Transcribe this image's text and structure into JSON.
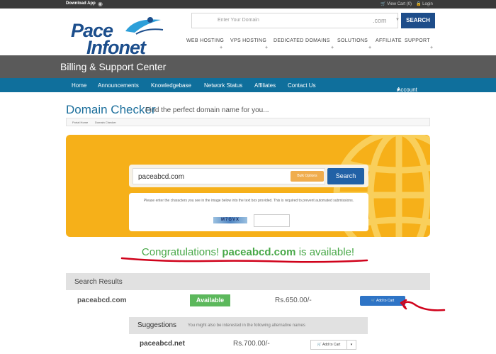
{
  "topbar": {
    "download": "Download App",
    "cart": "View Cart (0)",
    "login": "Login"
  },
  "logo": {
    "line1": "Pace",
    "line2": "Infonet",
    "tm": "TM"
  },
  "header_search": {
    "placeholder": "Enter Your Domain",
    "tld": ".com",
    "button": "SEARCH"
  },
  "top_nav": [
    "WEB HOSTING",
    "VPS HOSTING",
    "DEDICATED",
    "DOMAINS",
    "SOLUTIONS",
    "AFFILIATE",
    "SUPPORT"
  ],
  "banner": {
    "title": "Billing & Support Center"
  },
  "main_nav": {
    "items": [
      "Home",
      "Announcements",
      "Knowledgebase",
      "Network Status",
      "Affiliates",
      "Contact Us"
    ],
    "account": "Account"
  },
  "page": {
    "title": "Domain Checker",
    "subtitle": "Find the perfect domain name for you...",
    "breadcrumb": [
      "Portal Home",
      "Domain Checker"
    ]
  },
  "domain_search": {
    "value": "paceabcd.com",
    "bulk": "Bulk Options",
    "button": "Search",
    "captcha_text": "Please enter the characters you see in the image below into the text box provided. This is required to prevent automated submissions.",
    "captcha_code": "M7GVX"
  },
  "congrats": {
    "prefix": "Congratulations!",
    "domain": "paceabcd.com",
    "suffix": "is available!"
  },
  "results": {
    "header": "Search Results",
    "domain": "paceabcd.com",
    "status": "Available",
    "price": "Rs.650.00/-",
    "add_to_cart": "Add to Cart"
  },
  "suggestions": {
    "header": "Suggestions",
    "description": "You might also be interested in the following alternative names",
    "items": [
      {
        "domain": "paceabcd.net",
        "price": "Rs.700.00/-",
        "add_to_cart": "Add to Cart"
      }
    ]
  },
  "colors": {
    "brand_blue": "#1e4d8a",
    "nav_blue": "#0f6f9c",
    "banner_gray": "#5a5a5a",
    "panel_yellow": "#f6b019",
    "available_green": "#5cb85c",
    "annotation_red": "#d0021b"
  }
}
